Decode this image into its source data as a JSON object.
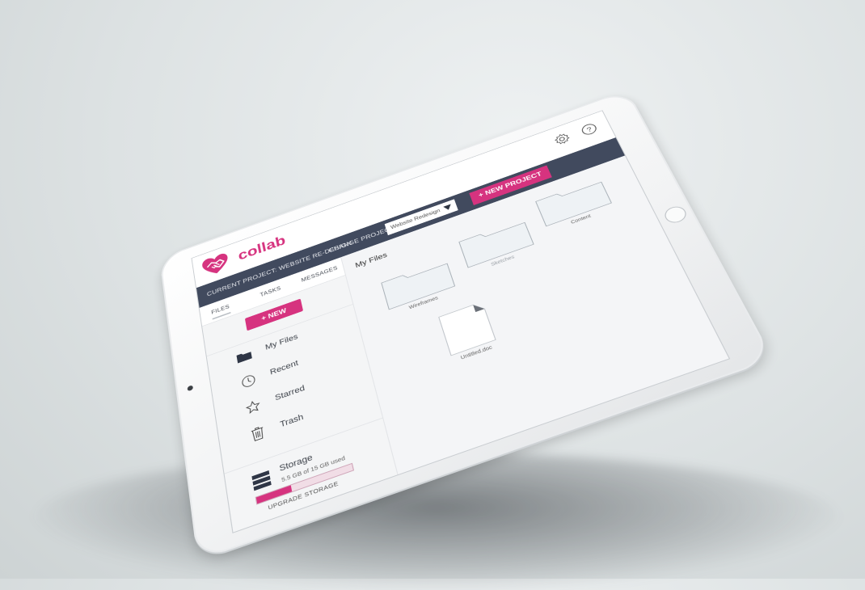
{
  "app": {
    "brand": "collab",
    "brand_color": "#d6337f",
    "icons": {
      "settings": "gear-icon",
      "help": "help-circle-icon"
    }
  },
  "project_bar": {
    "current_project": "CURRENT PROJECT: WEBSITE RE-DESIGN",
    "change_project_label": "CHANGE PROJECT:",
    "selected_project": "Website Redesign",
    "new_project_label": "+ NEW PROJECT",
    "bar_color": "#414a5e"
  },
  "sidebar": {
    "tabs": [
      {
        "label": "FILES",
        "active": true
      },
      {
        "label": "TASKS",
        "active": false
      },
      {
        "label": "MESSAGES",
        "active": false
      }
    ],
    "new_button": "+ NEW",
    "items": [
      {
        "label": "My Files",
        "icon": "folder-icon"
      },
      {
        "label": "Recent",
        "icon": "clock-icon"
      },
      {
        "label": "Starred",
        "icon": "star-icon"
      },
      {
        "label": "Trash",
        "icon": "trash-icon"
      }
    ],
    "storage": {
      "title": "Storage",
      "used_text": "5.5 GB of 15 GB used",
      "used_fraction": 0.3667,
      "upgrade_label": "UPGRADE STORAGE"
    }
  },
  "main": {
    "heading": "My Files",
    "folders": [
      {
        "name": "Wireframes"
      },
      {
        "name": "Sketches"
      },
      {
        "name": "Content"
      }
    ],
    "files": [
      {
        "name": "Untitled.doc"
      }
    ]
  }
}
